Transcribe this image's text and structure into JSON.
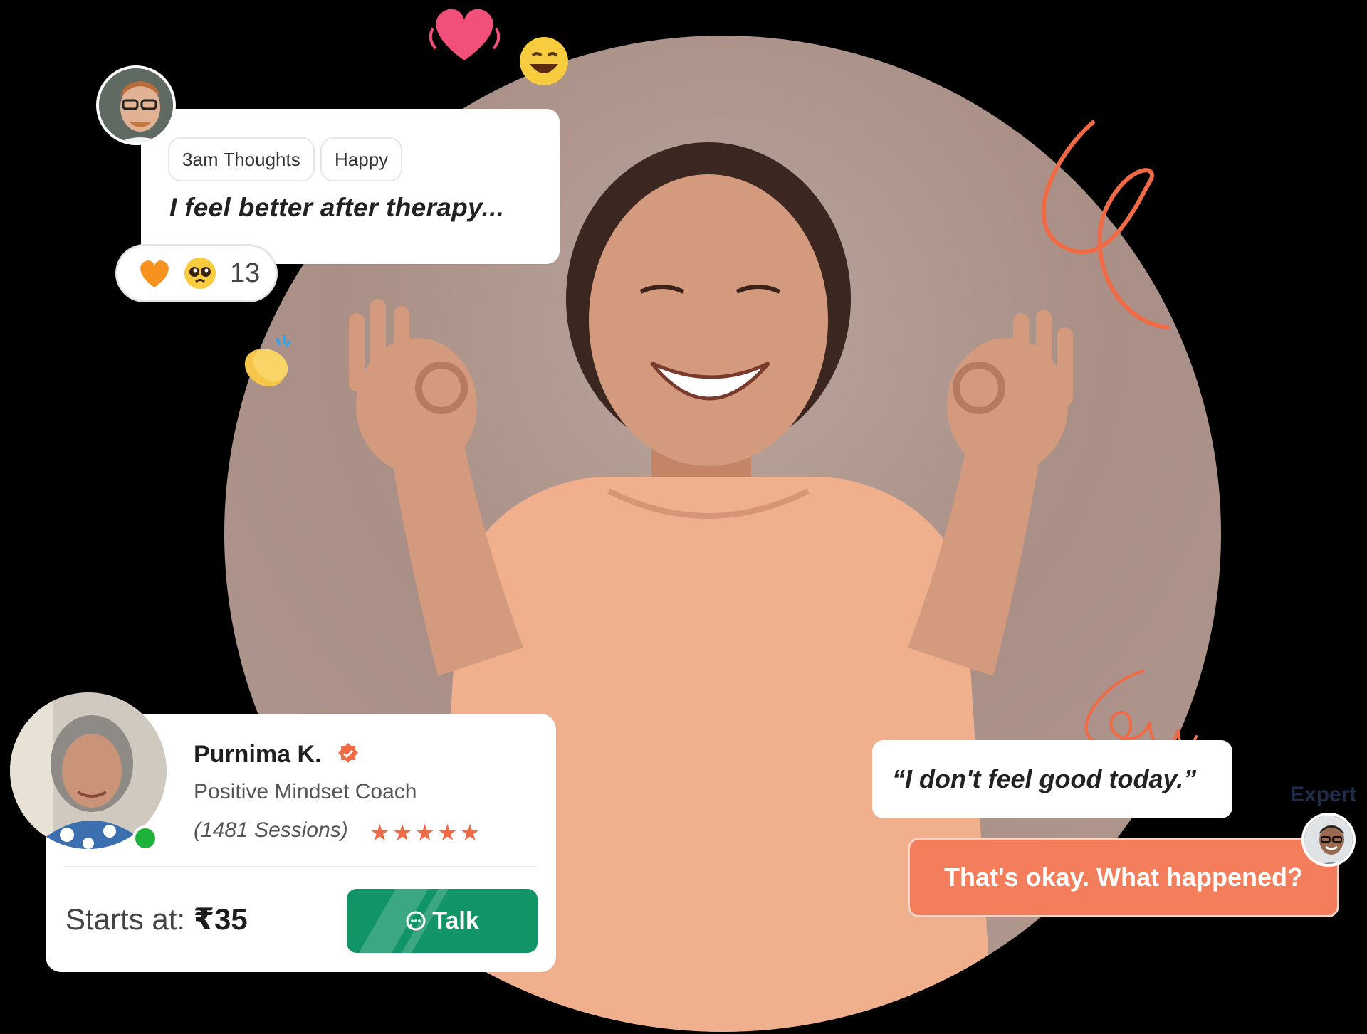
{
  "post": {
    "tags": [
      "3am Thoughts",
      "Happy"
    ],
    "text": "I feel better after therapy...",
    "reaction_count": "13",
    "reaction_icons": [
      "orange-heart-icon",
      "pleading-face-icon"
    ]
  },
  "floating_icons": [
    "heart-icon",
    "grinning-face-icon",
    "clapping-hands-icon"
  ],
  "coach": {
    "name": "Purnima K.",
    "role": "Positive Mindset Coach",
    "sessions": "(1481 Sessions)",
    "rating_stars": 5,
    "online": true,
    "price_label": "Starts at:",
    "price_value": "₹35",
    "talk_label": "Talk"
  },
  "chat": {
    "user_message": "“I don't feel good today.”",
    "expert_label": "Expert",
    "expert_message": "That's okay. What happened?"
  },
  "colors": {
    "accent_orange": "#f06b45",
    "talk_green": "#129566",
    "expert_bubble": "#f47e5c",
    "online_dot": "#1db33b"
  }
}
